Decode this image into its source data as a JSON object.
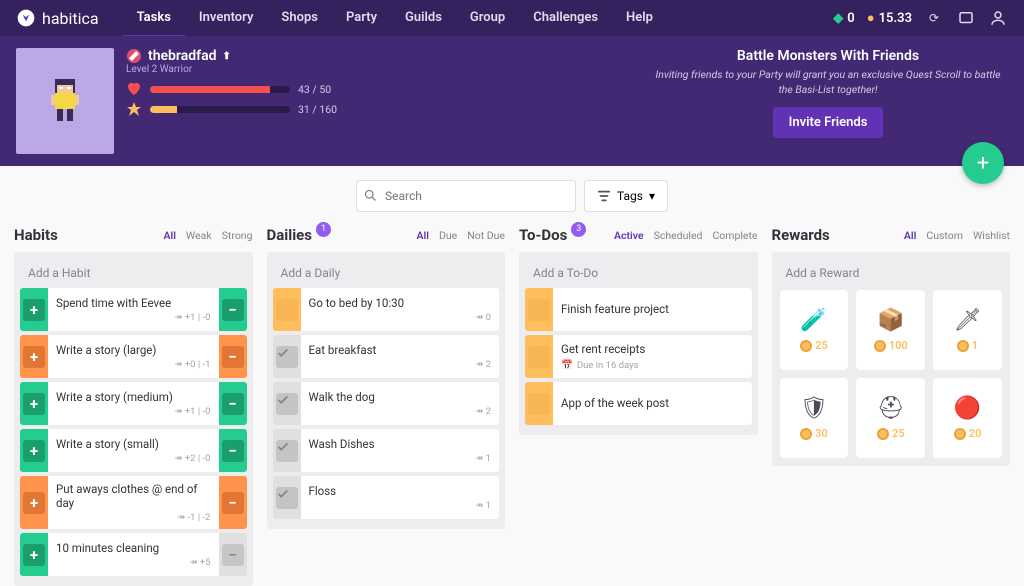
{
  "brand": "habitica",
  "nav": [
    "Tasks",
    "Inventory",
    "Shops",
    "Party",
    "Guilds",
    "Group",
    "Challenges",
    "Help"
  ],
  "nav_active": 0,
  "gems": "0",
  "gold": "15.33",
  "player": {
    "name": "thebradfad",
    "sub": "Level 2 Warrior",
    "hp": "43 / 50",
    "hp_pct": 86,
    "xp": "31 / 160",
    "xp_pct": 19
  },
  "party": {
    "title": "Battle Monsters With Friends",
    "blurb": "Inviting friends to your Party will grant you an exclusive Quest Scroll to battle the Basi-List together!",
    "btn": "Invite Friends"
  },
  "search_ph": "Search",
  "tags_label": "Tags",
  "cols": {
    "habits": {
      "title": "Habits",
      "filters": [
        "All",
        "Weak",
        "Strong"
      ],
      "active": 0,
      "add": "Add a Habit",
      "items": [
        {
          "t": "Spend time with Eevee",
          "sub": "↠ +1 | -0",
          "l": "g",
          "r": "g"
        },
        {
          "t": "Write a story (large)",
          "sub": "↠ +0 | -1",
          "l": "o",
          "r": "o"
        },
        {
          "t": "Write a story (medium)",
          "sub": "↠ +1 | -0",
          "l": "g",
          "r": "g"
        },
        {
          "t": "Write a story (small)",
          "sub": "↠ +2 | -0",
          "l": "g",
          "r": "g"
        },
        {
          "t": "Put aways clothes @ end of day",
          "sub": "↠ -1 | -2",
          "l": "o",
          "r": "o"
        },
        {
          "t": "10 minutes cleaning",
          "sub": "↠ +5",
          "l": "g",
          "r": "gr"
        }
      ]
    },
    "dailies": {
      "title": "Dailies",
      "badge": "1",
      "filters": [
        "All",
        "Due",
        "Not Due"
      ],
      "active": 0,
      "add": "Add a Daily",
      "items": [
        {
          "t": "Go to bed by 10:30",
          "sub": "↠ 0",
          "l": "y"
        },
        {
          "t": "Eat breakfast",
          "sub": "↠ 2",
          "l": "gr",
          "done": true
        },
        {
          "t": "Walk the dog",
          "sub": "↠ 2",
          "l": "gr",
          "done": true
        },
        {
          "t": "Wash Dishes",
          "sub": "↠ 1",
          "l": "gr",
          "done": true
        },
        {
          "t": "Floss",
          "sub": "↠ 1",
          "l": "gr",
          "done": true
        }
      ]
    },
    "todos": {
      "title": "To-Dos",
      "badge": "3",
      "filters": [
        "Active",
        "Scheduled",
        "Complete"
      ],
      "active": 0,
      "add": "Add a To-Do",
      "items": [
        {
          "t": "Finish feature project",
          "l": "y"
        },
        {
          "t": "Get rent receipts",
          "due": "Due in 16 days",
          "l": "y"
        },
        {
          "t": "App of the week post",
          "l": "y"
        }
      ]
    },
    "rewards": {
      "title": "Rewards",
      "filters": [
        "All",
        "Custom",
        "Wishlist"
      ],
      "active": 0,
      "add": "Add a Reward",
      "items": [
        {
          "icon": "🧪",
          "price": "25"
        },
        {
          "icon": "📦",
          "price": "100"
        },
        {
          "icon": "🗡",
          "price": "1"
        },
        {
          "icon": "🛡",
          "price": "30"
        },
        {
          "icon": "⛑",
          "price": "25"
        },
        {
          "icon": "🔴",
          "price": "20"
        }
      ]
    }
  }
}
